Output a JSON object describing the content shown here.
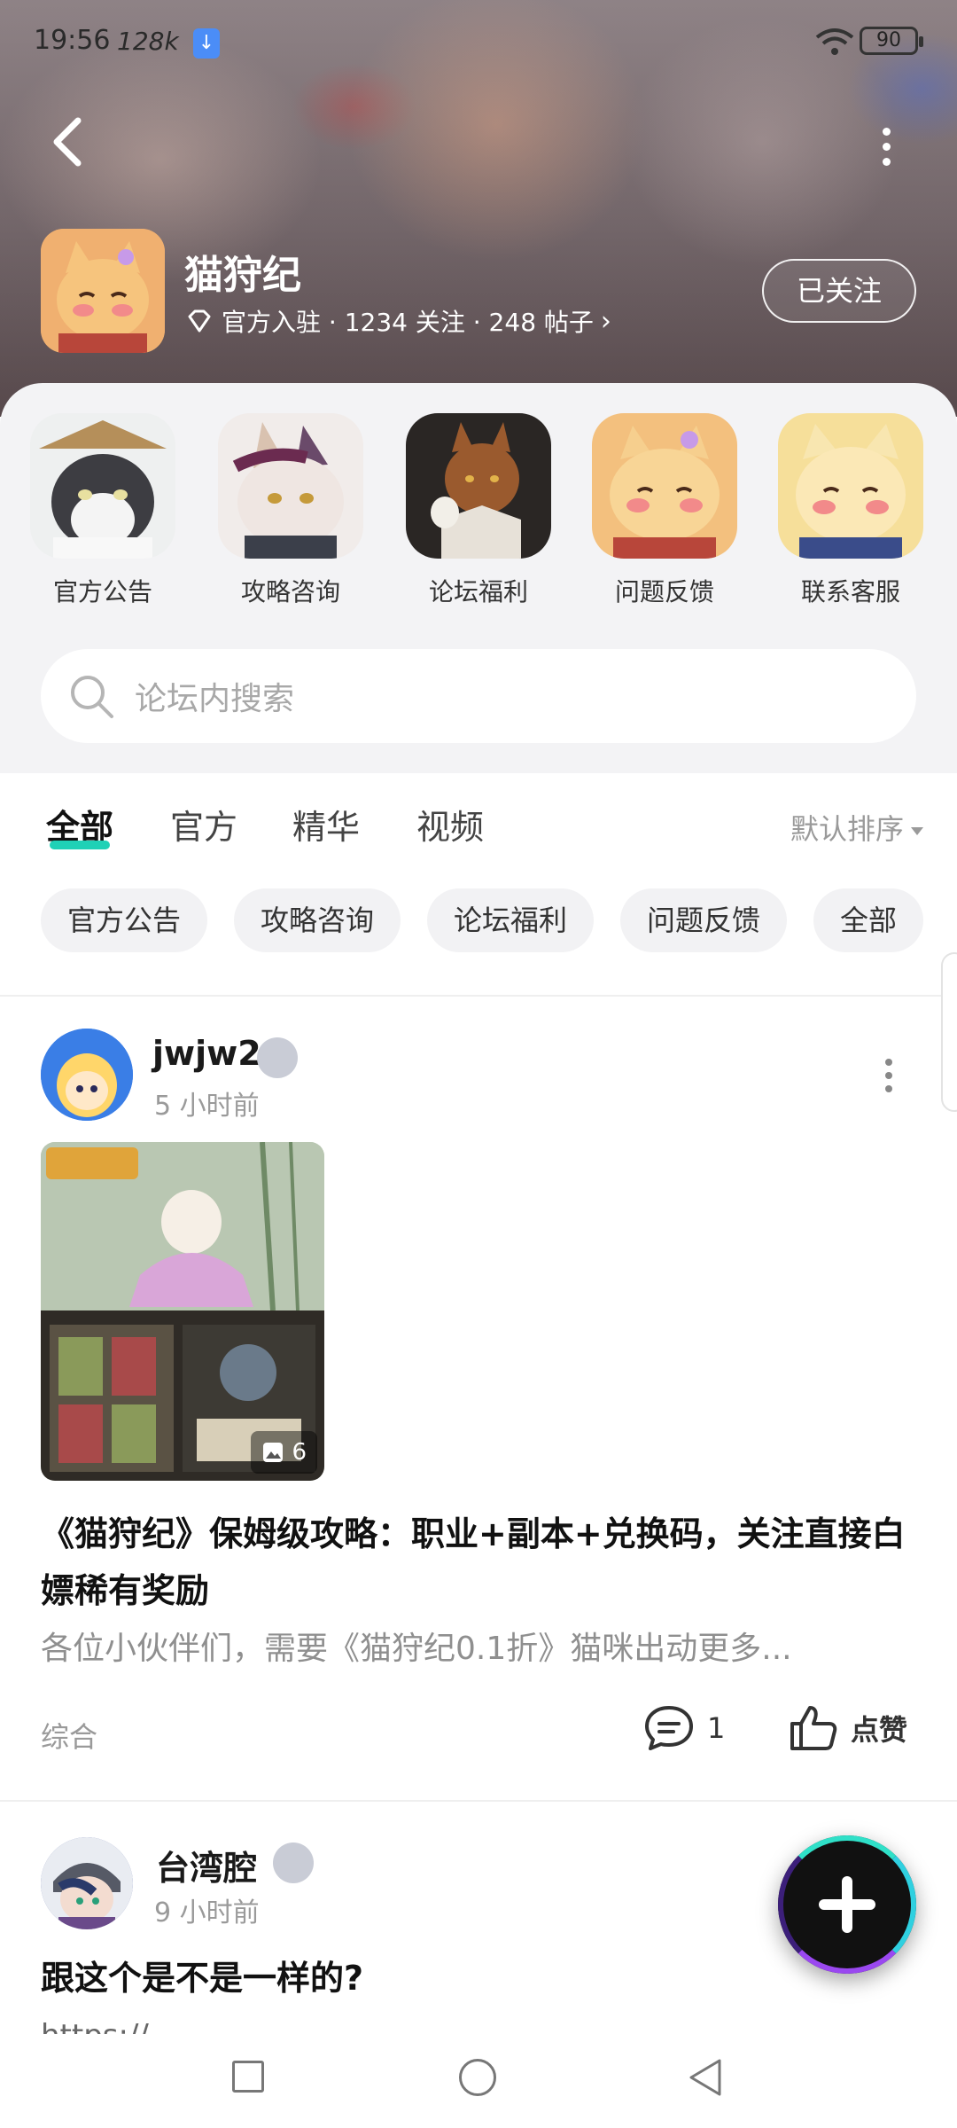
{
  "status_bar": {
    "time": "19:56",
    "speed": "128k",
    "battery": "90"
  },
  "forum": {
    "title": "猫狩纪",
    "meta": "官方入驻 · 1234 关注 · 248 帖子",
    "follow_label": "已关注"
  },
  "shortcuts": [
    {
      "label": "官方公告"
    },
    {
      "label": "攻略咨询"
    },
    {
      "label": "论坛福利"
    },
    {
      "label": "问题反馈"
    },
    {
      "label": "联系客服"
    }
  ],
  "search": {
    "placeholder": "论坛内搜索"
  },
  "tabs": [
    {
      "label": "全部",
      "active": true
    },
    {
      "label": "官方"
    },
    {
      "label": "精华"
    },
    {
      "label": "视频"
    }
  ],
  "sort_label": "默认排序",
  "chips": [
    "官方公告",
    "攻略咨询",
    "论坛福利",
    "问题反馈",
    "全部"
  ],
  "posts": [
    {
      "user": "jwjw2",
      "time": "5 小时前",
      "image_count": "6",
      "title": "《猫狩纪》保姆级攻略：职业+副本+兑换码，关注直接白嫖稀有奖励",
      "excerpt": "各位小伙伴们，需要《猫狩纪0.1折》猫咪出动更多...",
      "category": "综合",
      "comments": "1",
      "like_label": "点赞"
    },
    {
      "user": "台湾腔",
      "time": "9 小时前",
      "title": "跟这个是不是一样的?",
      "link_preview": "https://"
    }
  ],
  "colors": {
    "accent": "#1fd1b6",
    "banner": "#6d5f63"
  }
}
